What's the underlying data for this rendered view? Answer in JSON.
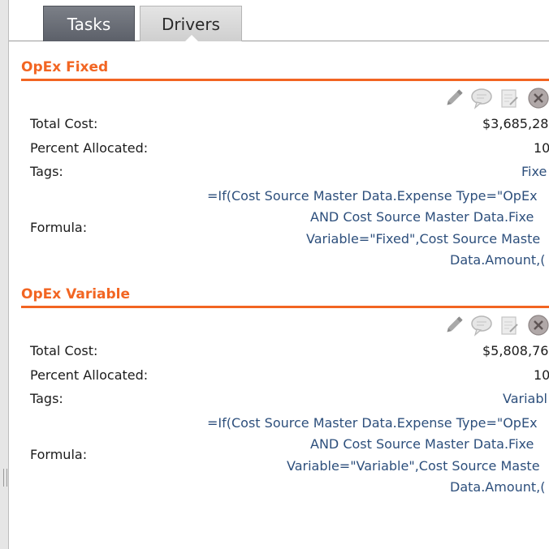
{
  "tabs": [
    {
      "label": "Tasks",
      "active": false
    },
    {
      "label": "Drivers",
      "active": true
    }
  ],
  "icons": [
    "pencil-icon",
    "comment-icon",
    "note-icon",
    "delete-icon"
  ],
  "colors": {
    "section_title": "#f26522",
    "value_text": "#2d4f7c",
    "tab_dark": "#5c6069",
    "tab_light": "#d6d6d6"
  },
  "drivers": [
    {
      "title": "OpEx Fixed",
      "total_cost_label": "Total Cost:",
      "total_cost_value": "$3,685,28",
      "percent_label": "Percent Allocated:",
      "percent_value": "10",
      "tags_label": "Tags:",
      "tags_value": "Fixe",
      "formula_label": "Formula:",
      "formula_lines": [
        "=If(Cost Source Master Data.Expense Type=\"OpEx",
        "AND Cost Source Master Data.Fixe",
        "Variable=\"Fixed\",Cost Source Maste",
        "Data.Amount,("
      ]
    },
    {
      "title": "OpEx Variable",
      "total_cost_label": "Total Cost:",
      "total_cost_value": "$5,808,76",
      "percent_label": "Percent Allocated:",
      "percent_value": "10",
      "tags_label": "Tags:",
      "tags_value": "Variabl",
      "formula_label": "Formula:",
      "formula_lines": [
        "=If(Cost Source Master Data.Expense Type=\"OpEx",
        "AND Cost Source Master Data.Fixe",
        "Variable=\"Variable\",Cost Source Maste",
        "Data.Amount,("
      ]
    }
  ]
}
